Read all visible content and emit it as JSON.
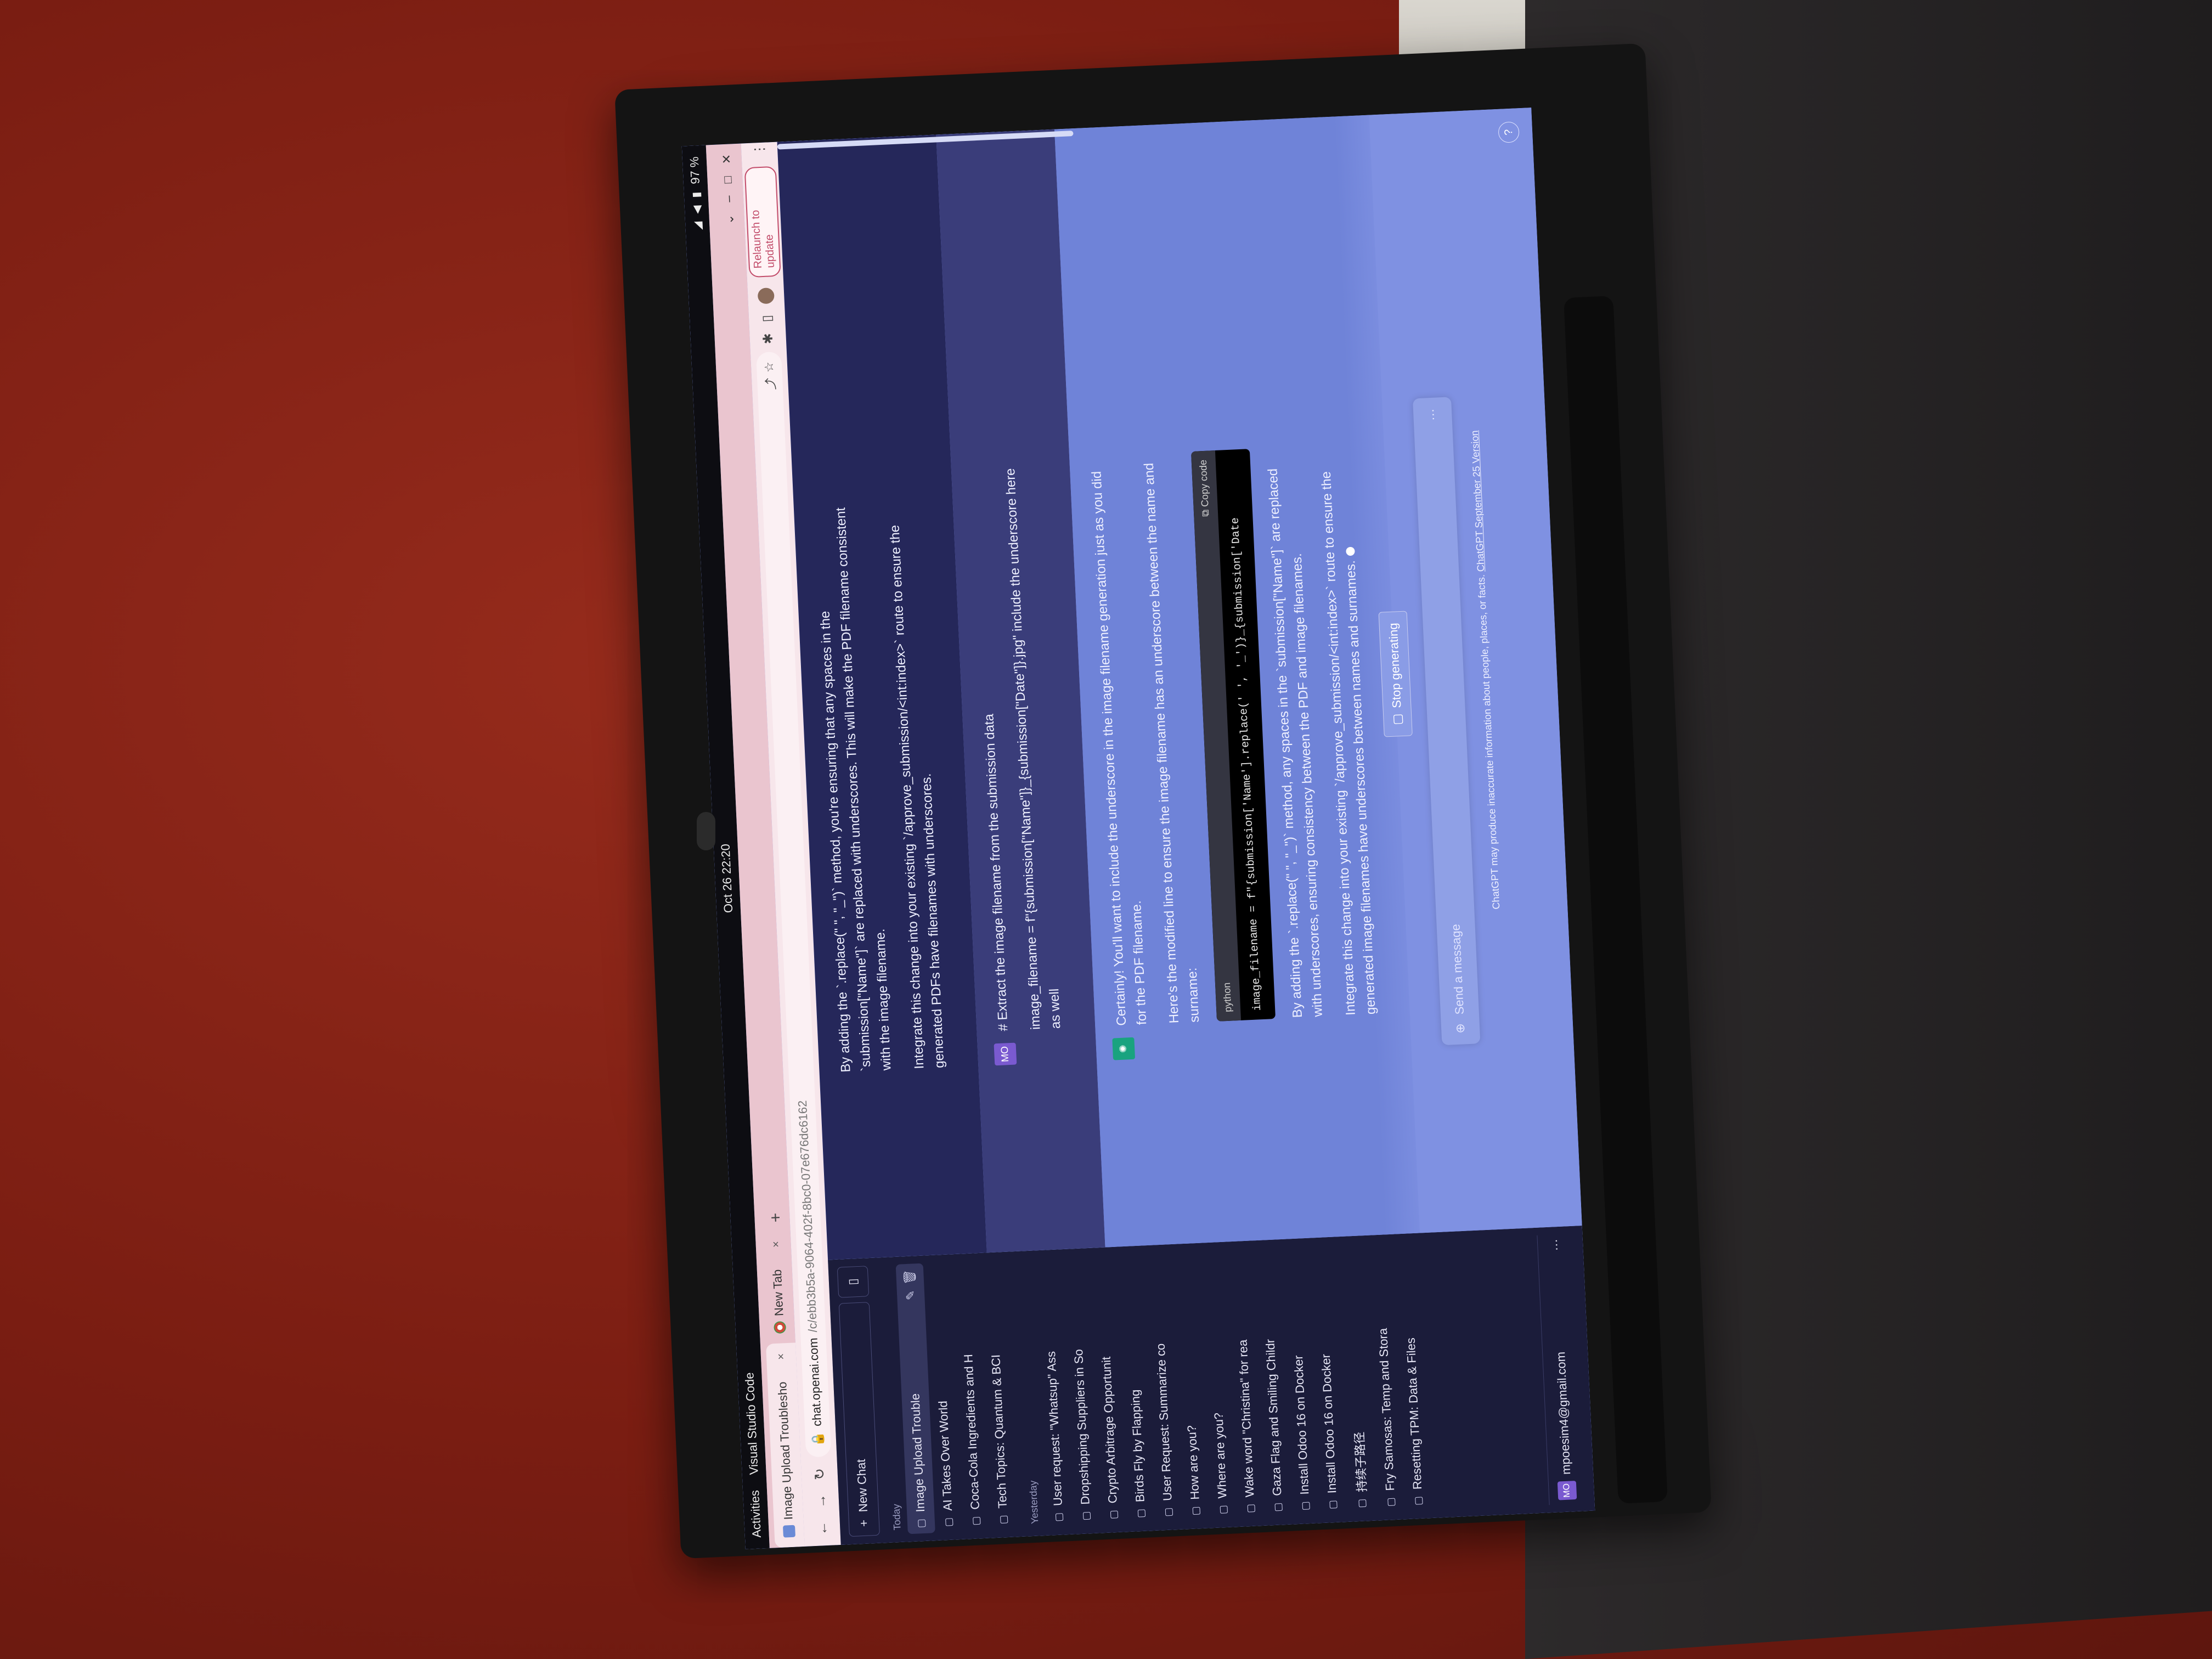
{
  "topbar": {
    "activities": "Activities",
    "app": "Visual Studio Code",
    "clock": "Oct 26  22:20",
    "battery": "97 %"
  },
  "tabs": [
    {
      "label": "Image Upload Troublesho",
      "close": "×"
    },
    {
      "label": "New Tab",
      "close": "×"
    }
  ],
  "newtab": "+",
  "toolbar": {
    "url_host": "chat.openai.com",
    "url_path": "/c/ebb3b5a-9064-402f-8bc0-07e676dc6162",
    "relaunch": "Relaunch to update"
  },
  "sidebar": {
    "new_chat": "New Chat",
    "groups": [
      {
        "label": "Today",
        "items": [
          "Image Upload Trouble",
          "AI Takes Over World",
          "Coca-Cola Ingredients and H",
          "Tech Topics: Quantum & BCI"
        ]
      },
      {
        "label": "Yesterday",
        "items": [
          "User request: \"Whatsup\" Ass",
          "Dropshipping Suppliers in So",
          "Crypto Arbitrage Opportunit",
          "Birds Fly by Flapping",
          "User Request: Summarize co",
          "How are you?",
          "Where are you?",
          "Wake word \"Christina\" for rea",
          "Gaza Flag and Smiling Childr",
          "Install Odoo 16 on Docker",
          "Install Odoo 16 on Docker",
          "持续子路径",
          "Fry Samosas: Temp and Stora",
          "Resetting TPM: Data & Files"
        ]
      }
    ],
    "user": {
      "initials": "MO",
      "email": "mpoesim4@gmail.com",
      "more": "···"
    }
  },
  "chat": {
    "assistant1": [
      "By adding the `.replace(\" \", \"_\")` method, you're ensuring that any spaces in the `submission[\"Name\"]` are replaced with underscores. This will make the PDF filename consistent with the image filename.",
      "Integrate this change into your existing `/approve_submission/<int:index>` route to ensure the generated PDFs have filenames with underscores."
    ],
    "user": {
      "initials": "MO",
      "lines": [
        "# Extract the image filename from the submission data",
        "image_filename = f\"{submission[\"Name\"]}_{submission[\"Date\"]}.jpg\" include the underscore here as well"
      ]
    },
    "assistant2": {
      "p1": "Certainly! You'll want to include the underscore in the image filename generation just as you did for the PDF filename.",
      "p2": "Here's the modified line to ensure the image filename has an underscore between the name and surname:",
      "code_lang": "python",
      "copy": "Copy code",
      "code": "image_filename = f\"{submission['Name'].replace(' ', '_')}_{submission['Date",
      "p3": "By adding the `.replace(\" \", \"_\")` method, any spaces in the `submission[\"Name\"]` are replaced with underscores, ensuring consistency between the PDF and image filenames.",
      "p4": "Integrate this change into your existing `/approve_submission/<int:index>` route to ensure the generated image filenames have underscores between names and surnames."
    }
  },
  "composer": {
    "stop": "Stop generating",
    "placeholder": "Send a message",
    "disclaimer": "ChatGPT may produce inaccurate information about people, places, or facts.",
    "version_link": "ChatGPT September 25 Version",
    "help": "?"
  }
}
